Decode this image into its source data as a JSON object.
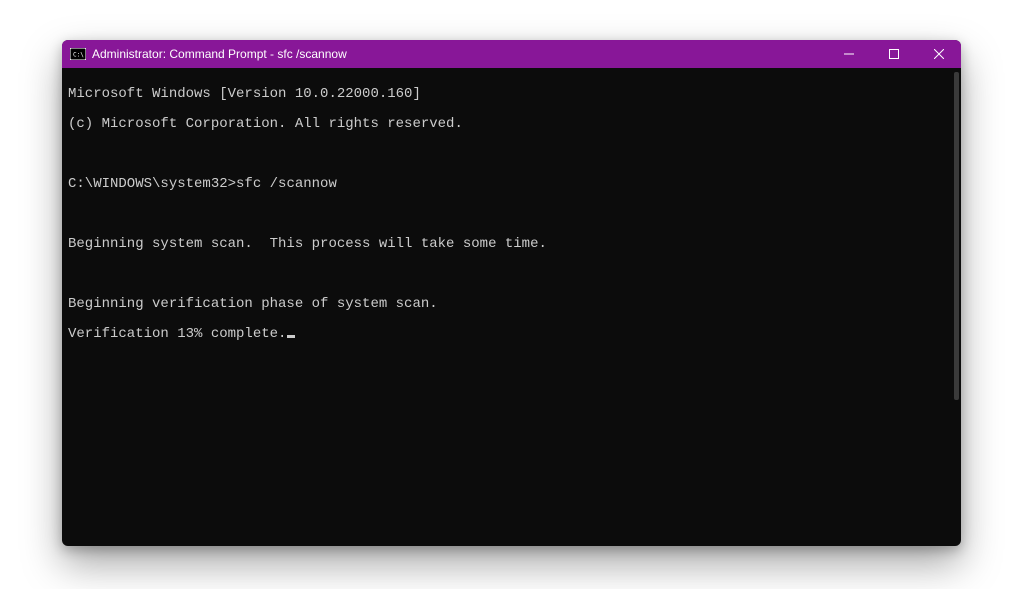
{
  "window": {
    "title": "Administrator: Command Prompt - sfc  /scannow",
    "accent_color": "#881798",
    "background_color": "#0c0c0c",
    "text_color": "#cccccc"
  },
  "terminal": {
    "header1": "Microsoft Windows [Version 10.0.22000.160]",
    "header2": "(c) Microsoft Corporation. All rights reserved.",
    "prompt_path": "C:\\WINDOWS\\system32>",
    "command": "sfc /scannow",
    "msg_begin_scan": "Beginning system scan.  This process will take some time.",
    "msg_verify_phase": "Beginning verification phase of system scan.",
    "msg_progress": "Verification 13% complete."
  }
}
